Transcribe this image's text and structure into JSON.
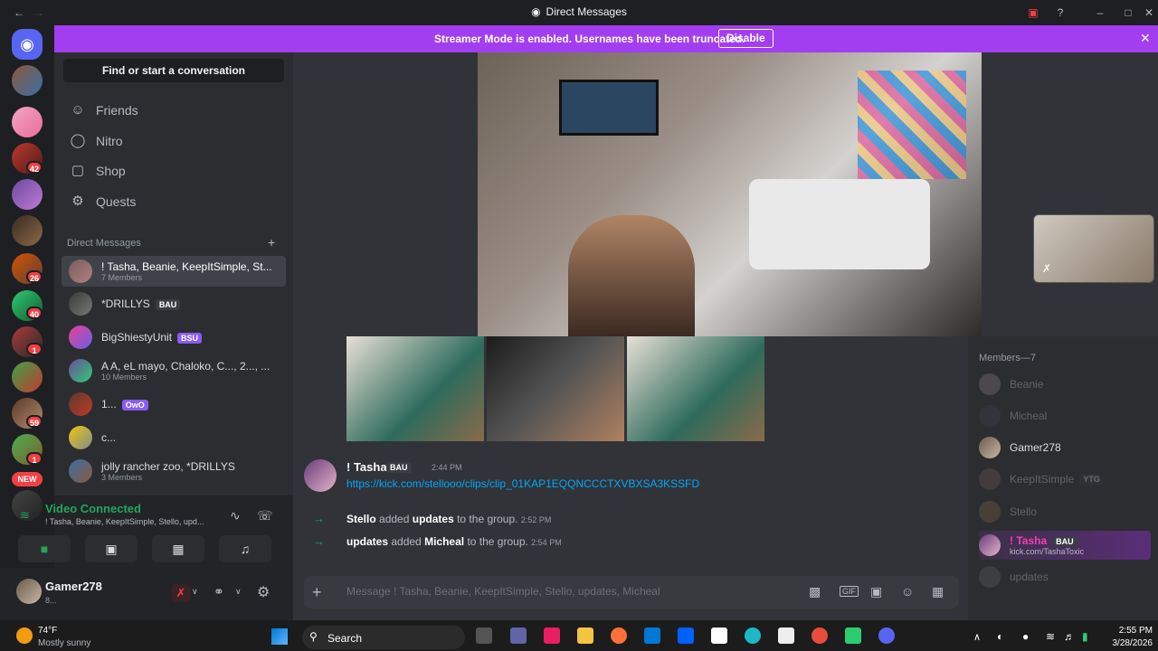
{
  "window": {
    "title": "Direct Messages"
  },
  "banner": {
    "text": "Streamer Mode is enabled. Usernames have been truncated.",
    "button": "Disable"
  },
  "servers": {
    "badges": [
      "42",
      "26",
      "40",
      "1",
      "59",
      "1"
    ],
    "new_label": "NEW"
  },
  "sidebar": {
    "search_label": "Find or start a conversation",
    "nav": [
      {
        "label": "Friends",
        "icon": "friends-icon"
      },
      {
        "label": "Nitro",
        "icon": "nitro-icon"
      },
      {
        "label": "Shop",
        "icon": "shop-icon"
      },
      {
        "label": "Quests",
        "icon": "quests-icon"
      }
    ],
    "dm_header": "Direct Messages",
    "dms": [
      {
        "name": "! Tasha, Beanie, KeepItSimple, St...",
        "sub": "7 Members"
      },
      {
        "name": "*DRILLYS",
        "tag": "BAU"
      },
      {
        "name": "BigShiestyUnit",
        "tag": "BSU"
      },
      {
        "name": "A A, eL mayo, Chaloko, C..., 2..., ...",
        "sub": "10 Members"
      },
      {
        "name": "1...",
        "tag": "OwO"
      },
      {
        "name": "c..."
      },
      {
        "name": "jolly rancher zoo, *DRILLYS",
        "sub": "3 Members"
      }
    ]
  },
  "voice": {
    "title": "Video Connected",
    "sub": "! Tasha, Beanie, KeepItSimple, Stello, upd..."
  },
  "user": {
    "name": "Gamer278",
    "status": "8..."
  },
  "messages": {
    "author": "! Tasha",
    "author_tag": "BAU",
    "time": "2:44 PM",
    "link": "https://kick.com/stellooo/clips/clip_01KAP1EQQNCCCTXVBXSA3KSSFD",
    "sys1": {
      "who": "Stello",
      "verb": "added",
      "target": "updates",
      "tail": "to the group.",
      "time": "2:52 PM"
    },
    "sys2": {
      "who": "updates",
      "verb": "added",
      "target": "Micheal",
      "tail": "to the group.",
      "time": "2:54 PM"
    }
  },
  "composer": {
    "placeholder": "Message ! Tasha, Beanie, KeepItSimple, Stello, updates, Micheal"
  },
  "members": {
    "header": "Members—7",
    "list": [
      {
        "name": "Beanie",
        "dim": true
      },
      {
        "name": "Micheal",
        "dim": true
      },
      {
        "name": "Gamer278",
        "dim": false
      },
      {
        "name": "KeepItSimple",
        "tag": "YTG",
        "dim": true
      },
      {
        "name": "Stello",
        "dim": true
      },
      {
        "name": "! Tasha",
        "tag": "BAU",
        "status": "kick.com/TashaToxic",
        "dim": false
      },
      {
        "name": "updates",
        "dim": true
      }
    ]
  },
  "taskbar": {
    "weather_temp": "74°F",
    "weather_desc": "Mostly sunny",
    "search": "Search",
    "time": "2:55 PM",
    "date": "3/28/2026"
  },
  "colors": {
    "accent": "#5865f2",
    "banner": "#a33ef0",
    "link": "#00a8fc",
    "green": "#23a55a",
    "red": "#f23f43"
  }
}
